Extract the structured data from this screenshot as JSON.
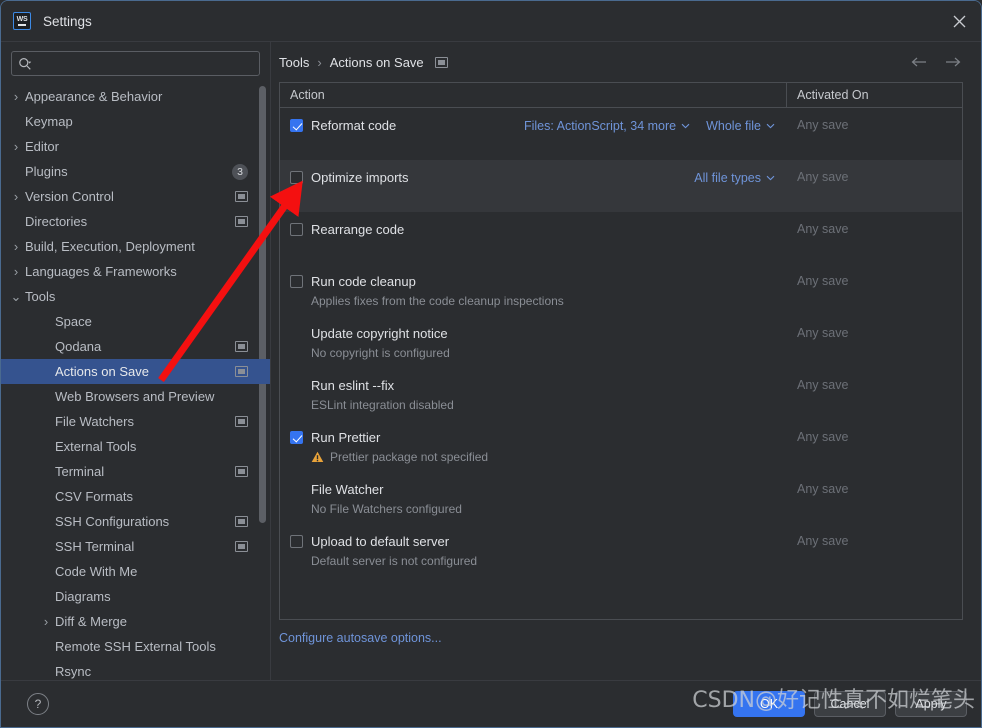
{
  "window": {
    "title": "Settings",
    "logo_text": "WS",
    "close_icon": "close-icon"
  },
  "search": {
    "value": "",
    "placeholder": "",
    "icon": "search-icon"
  },
  "sidebar": {
    "items": [
      {
        "label": "Appearance & Behavior",
        "arrow": "›",
        "indent": 0,
        "selected": false,
        "badge": null,
        "icon": false
      },
      {
        "label": "Keymap",
        "arrow": "",
        "indent": 0,
        "selected": false,
        "badge": null,
        "icon": false
      },
      {
        "label": "Editor",
        "arrow": "›",
        "indent": 0,
        "selected": false,
        "badge": null,
        "icon": false
      },
      {
        "label": "Plugins",
        "arrow": "",
        "indent": 0,
        "selected": false,
        "badge": "3",
        "icon": false
      },
      {
        "label": "Version Control",
        "arrow": "›",
        "indent": 0,
        "selected": false,
        "badge": null,
        "icon": true
      },
      {
        "label": "Directories",
        "arrow": "",
        "indent": 0,
        "selected": false,
        "badge": null,
        "icon": true
      },
      {
        "label": "Build, Execution, Deployment",
        "arrow": "›",
        "indent": 0,
        "selected": false,
        "badge": null,
        "icon": false
      },
      {
        "label": "Languages & Frameworks",
        "arrow": "›",
        "indent": 0,
        "selected": false,
        "badge": null,
        "icon": false
      },
      {
        "label": "Tools",
        "arrow": "⌄",
        "indent": 0,
        "selected": false,
        "badge": null,
        "icon": false
      },
      {
        "label": "Space",
        "arrow": "",
        "indent": 1,
        "selected": false,
        "badge": null,
        "icon": false
      },
      {
        "label": "Qodana",
        "arrow": "",
        "indent": 1,
        "selected": false,
        "badge": null,
        "icon": true
      },
      {
        "label": "Actions on Save",
        "arrow": "",
        "indent": 1,
        "selected": true,
        "badge": null,
        "icon": true
      },
      {
        "label": "Web Browsers and Preview",
        "arrow": "",
        "indent": 1,
        "selected": false,
        "badge": null,
        "icon": false
      },
      {
        "label": "File Watchers",
        "arrow": "",
        "indent": 1,
        "selected": false,
        "badge": null,
        "icon": true
      },
      {
        "label": "External Tools",
        "arrow": "",
        "indent": 1,
        "selected": false,
        "badge": null,
        "icon": false
      },
      {
        "label": "Terminal",
        "arrow": "",
        "indent": 1,
        "selected": false,
        "badge": null,
        "icon": true
      },
      {
        "label": "CSV Formats",
        "arrow": "",
        "indent": 1,
        "selected": false,
        "badge": null,
        "icon": false
      },
      {
        "label": "SSH Configurations",
        "arrow": "",
        "indent": 1,
        "selected": false,
        "badge": null,
        "icon": true
      },
      {
        "label": "SSH Terminal",
        "arrow": "",
        "indent": 1,
        "selected": false,
        "badge": null,
        "icon": true
      },
      {
        "label": "Code With Me",
        "arrow": "",
        "indent": 1,
        "selected": false,
        "badge": null,
        "icon": false
      },
      {
        "label": "Diagrams",
        "arrow": "",
        "indent": 1,
        "selected": false,
        "badge": null,
        "icon": false
      },
      {
        "label": "Diff & Merge",
        "arrow": "›",
        "indent": 1,
        "selected": false,
        "badge": null,
        "icon": false
      },
      {
        "label": "Remote SSH External Tools",
        "arrow": "",
        "indent": 1,
        "selected": false,
        "badge": null,
        "icon": false
      },
      {
        "label": "Rsync",
        "arrow": "",
        "indent": 1,
        "selected": false,
        "badge": null,
        "icon": false
      }
    ]
  },
  "breadcrumb": {
    "parent": "Tools",
    "separator": "›",
    "current": "Actions on Save",
    "scope_icon": "project-scope-icon",
    "back_icon": "arrow-left-icon",
    "forward_icon": "arrow-right-icon"
  },
  "table": {
    "columns": [
      "Action",
      "Activated On"
    ],
    "rows": [
      {
        "title": "Reformat code",
        "checkbox": "checked",
        "subtitle": null,
        "warning": false,
        "links": [
          "Files: ActionScript, 34 more",
          "Whole file"
        ],
        "activated_on": "Any save",
        "highlight": false
      },
      {
        "title": "Optimize imports",
        "checkbox": "unchecked",
        "subtitle": null,
        "warning": false,
        "links": [
          "All file types"
        ],
        "activated_on": "Any save",
        "highlight": true
      },
      {
        "title": "Rearrange code",
        "checkbox": "unchecked",
        "subtitle": null,
        "warning": false,
        "links": [],
        "activated_on": "Any save",
        "highlight": false
      },
      {
        "title": "Run code cleanup",
        "checkbox": "unchecked",
        "subtitle": "Applies fixes from the code cleanup inspections",
        "warning": false,
        "links": [],
        "activated_on": "Any save",
        "highlight": false
      },
      {
        "title": "Update copyright notice",
        "checkbox": "none",
        "subtitle": "No copyright is configured",
        "warning": false,
        "links": [],
        "activated_on": "Any save",
        "highlight": false
      },
      {
        "title": "Run eslint --fix",
        "checkbox": "none",
        "subtitle": "ESLint integration disabled",
        "warning": false,
        "links": [],
        "activated_on": "Any save",
        "highlight": false
      },
      {
        "title": "Run Prettier",
        "checkbox": "checked",
        "subtitle": "Prettier package not specified",
        "warning": true,
        "links": [],
        "activated_on": "Any save",
        "highlight": false
      },
      {
        "title": "File Watcher",
        "checkbox": "none",
        "subtitle": "No File Watchers configured",
        "warning": false,
        "links": [],
        "activated_on": "Any save",
        "highlight": false
      },
      {
        "title": "Upload to default server",
        "checkbox": "unchecked",
        "subtitle": "Default server is not configured",
        "warning": false,
        "links": [],
        "activated_on": "Any save",
        "highlight": false
      }
    ]
  },
  "links": {
    "autosave": "Configure autosave options..."
  },
  "footer": {
    "help_label": "?",
    "buttons": [
      {
        "label": "OK",
        "primary": true
      },
      {
        "label": "Cancel",
        "primary": false
      },
      {
        "label": "Apply",
        "primary": false
      }
    ]
  },
  "watermark": {
    "text": "CSDN@好记性真不如烂笔头"
  },
  "colors": {
    "accent": "#3574f0",
    "selection": "#35538f",
    "link": "#6f94d9",
    "background": "#2b2d30",
    "row_highlight": "#35373b",
    "arrow_annotation": "#f41010",
    "warning": "#e9a33a"
  }
}
